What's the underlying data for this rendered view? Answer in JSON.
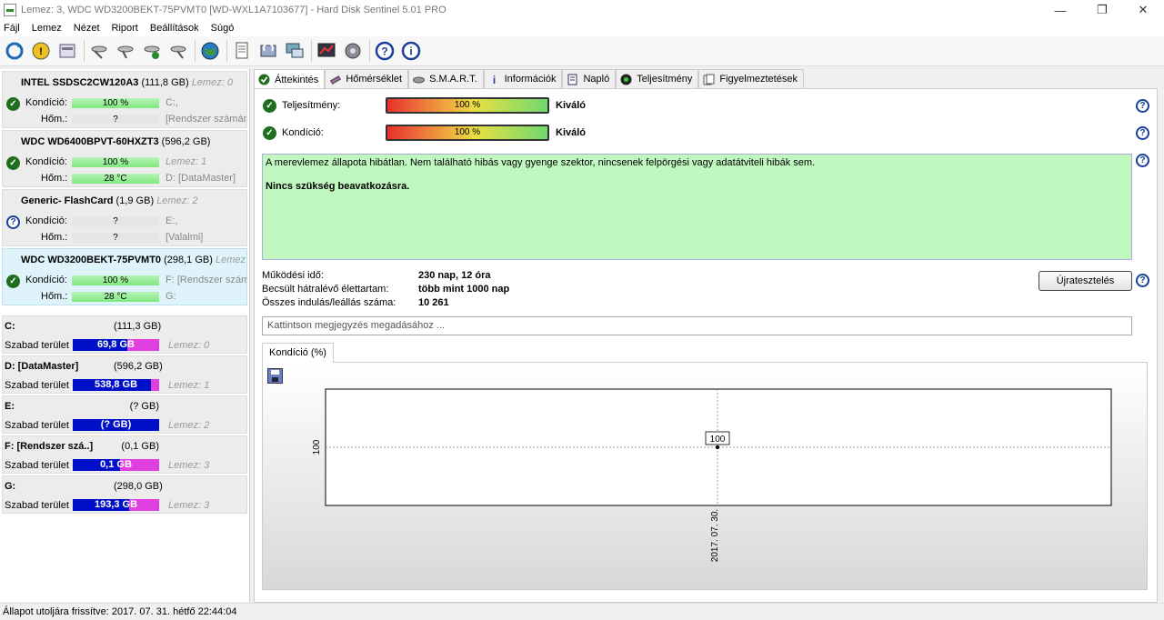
{
  "window": {
    "title": "Lemez: 3, WDC WD3200BEKT-75PVMT0 [WD-WXL1A7103677]  -  Hard Disk Sentinel 5.01 PRO",
    "minimize": "—",
    "maximize": "❐",
    "close": "✕"
  },
  "menu": [
    "Fájl",
    "Lemez",
    "Nézet",
    "Riport",
    "Beállítások",
    "Súgó"
  ],
  "toolbar": {
    "icons": [
      "refresh-icon",
      "warning-icon",
      "disk-icon",
      "disk-tool-1-icon",
      "disk-tool-2-icon",
      "disk-tool-3-icon",
      "disk-tool-4-icon",
      "globe-icon",
      "report-icon",
      "send-icon",
      "network-icon",
      "chart-icon",
      "settings-icon",
      "help-icon",
      "info-icon"
    ]
  },
  "disks": [
    {
      "name": "INTEL SSDSC2CW120A3",
      "size": "(111,8 GB)",
      "lemez": "Lemez: 0",
      "status": "ok",
      "kondicio_label": "Kondíció:",
      "kondicio": "100 %",
      "kondicio_pct": 100,
      "kondicio_info": "C:,",
      "hom_label": "Hőm.:",
      "hom": "?",
      "hom_info": "[Rendszer számára",
      "selected": false
    },
    {
      "name": "WDC WD6400BPVT-60HXZT3",
      "size": "(596,2 GB)",
      "lemez": "",
      "status": "ok",
      "kondicio_label": "Kondíció:",
      "kondicio": "100 %",
      "kondicio_pct": 100,
      "kondicio_info": "Lemez: 1",
      "hom_label": "Hőm.:",
      "hom": "28 °C",
      "hom_info": "D: [DataMaster]",
      "selected": false
    },
    {
      "name": "Generic- FlashCard",
      "size": "(1,9 GB)",
      "lemez": "Lemez: 2",
      "status": "q",
      "kondicio_label": "Kondíció:",
      "kondicio": "?",
      "kondicio_pct": 0,
      "kondicio_info": "E:,",
      "hom_label": "Hőm.:",
      "hom": "?",
      "hom_info": "[Valalmi]",
      "selected": false
    },
    {
      "name": "WDC WD3200BEKT-75PVMT0",
      "size": "(298,1 GB)",
      "lemez": "Lemez",
      "status": "ok",
      "kondicio_label": "Kondíció:",
      "kondicio": "100 %",
      "kondicio_pct": 100,
      "kondicio_info": "F: [Rendszer számá",
      "hom_label": "Hőm.:",
      "hom": "28 °C",
      "hom_info": "G:",
      "selected": true
    }
  ],
  "volumes": [
    {
      "name": "C:",
      "size": "(111,3 GB)",
      "label": "Szabad terület",
      "free": "69,8 GB",
      "free_fraction": 0.63,
      "lemez": "Lemez: 0"
    },
    {
      "name": "D: [DataMaster]",
      "size": "(596,2 GB)",
      "label": "Szabad terület",
      "free": "538,8 GB",
      "free_fraction": 0.9,
      "lemez": "Lemez: 1"
    },
    {
      "name": "E:",
      "size": "(? GB)",
      "label": "Szabad terület",
      "free": "(? GB)",
      "free_fraction": 1.0,
      "lemez": "Lemez: 2"
    },
    {
      "name": "F: [Rendszer szá..]",
      "size": "(0,1 GB)",
      "label": "Szabad terület",
      "free": "0,1 GB",
      "free_fraction": 0.55,
      "lemez": "Lemez: 3"
    },
    {
      "name": "G:",
      "size": "(298,0 GB)",
      "label": "Szabad terület",
      "free": "193,3 GB",
      "free_fraction": 0.65,
      "lemez": "Lemez: 3"
    }
  ],
  "tabs": [
    {
      "label": "Áttekintés",
      "icon": "check-icon",
      "active": true
    },
    {
      "label": "Hőmérséklet",
      "icon": "thermometer-icon",
      "active": false
    },
    {
      "label": "S.M.A.R.T.",
      "icon": "disk-icon",
      "active": false
    },
    {
      "label": "Információk",
      "icon": "info-icon",
      "active": false
    },
    {
      "label": "Napló",
      "icon": "log-icon",
      "active": false
    },
    {
      "label": "Teljesítmény",
      "icon": "performance-icon",
      "active": false
    },
    {
      "label": "Figyelmeztetések",
      "icon": "alerts-icon",
      "active": false
    }
  ],
  "overview": {
    "performance_label": "Teljesítmény:",
    "performance_value": "100 %",
    "performance_rating": "Kiváló",
    "condition_label": "Kondíció:",
    "condition_value": "100 %",
    "condition_rating": "Kiváló",
    "message": "A merevlemez állapota hibátlan. Nem található hibás vagy gyenge szektor, nincsenek felpörgési vagy adatátviteli hibák sem.",
    "recommendation": "Nincs szükség beavatkozásra.",
    "stats": [
      {
        "label": "Működési idő:",
        "value": "230 nap, 12 óra"
      },
      {
        "label": "Becsült hátralévő élettartam:",
        "value": "több mint 1000 nap"
      },
      {
        "label": "Összes indulás/leállás száma:",
        "value": "10 261"
      }
    ],
    "restart_button": "Újratesztelés",
    "note_placeholder": "Kattintson megjegyzés megadásához ..."
  },
  "graph": {
    "tab_label": "Kondíció  (%)"
  },
  "chart_data": {
    "type": "line",
    "x": [
      "2017. 07. 30."
    ],
    "series": [
      {
        "values": [
          100
        ]
      }
    ],
    "data_labels": [
      "100"
    ],
    "ylabel_tick": "100",
    "grid": true
  },
  "statusbar": "Állapot utoljára frissítve: 2017. 07. 31. hétfő 22:44:04",
  "colors": {
    "ok_green": "#1e6e1e",
    "message_bg": "#c0f8c0",
    "free_fill": "#0010c8",
    "volume_bg": "#e040e0",
    "help_blue": "#1a3f9a"
  }
}
